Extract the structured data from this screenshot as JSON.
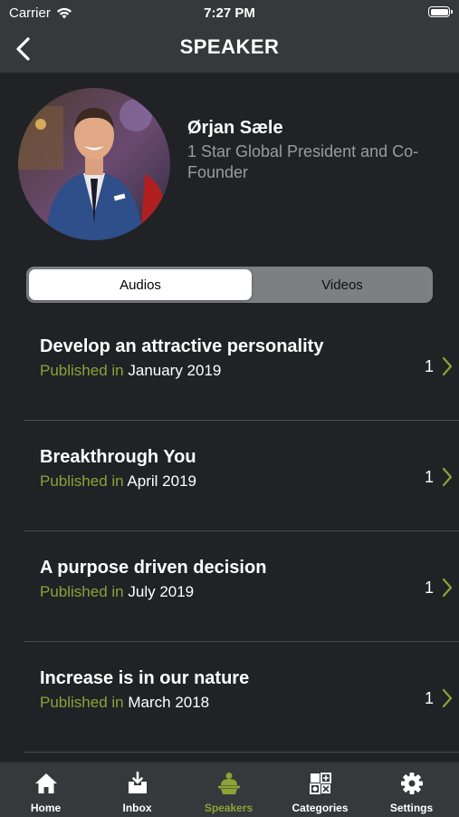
{
  "status_bar": {
    "carrier": "Carrier",
    "time": "7:27 PM"
  },
  "header": {
    "title": "SPEAKER",
    "back_icon": "chevron-left-icon"
  },
  "speaker": {
    "name": "Ørjan Sæle",
    "role": "1 Star Global President and Co-Founder"
  },
  "segments": {
    "audios": "Audios",
    "videos": "Videos",
    "selected": "Audios"
  },
  "published_label": "Published in",
  "items": [
    {
      "title": "Develop an attractive personality",
      "date": "January 2019",
      "count": "1"
    },
    {
      "title": "Breakthrough You",
      "date": "April 2019",
      "count": "1"
    },
    {
      "title": "A purpose driven decision",
      "date": "July 2019",
      "count": "1"
    },
    {
      "title": "Increase is in our nature",
      "date": "March 2018",
      "count": "1"
    }
  ],
  "tabs": [
    {
      "label": "Home",
      "icon": "home-icon"
    },
    {
      "label": "Inbox",
      "icon": "inbox-icon"
    },
    {
      "label": "Speakers",
      "icon": "speakers-icon"
    },
    {
      "label": "Categories",
      "icon": "categories-icon"
    },
    {
      "label": "Settings",
      "icon": "settings-icon"
    }
  ],
  "selected_tab": "Speakers",
  "colors": {
    "accent": "#8ba337",
    "background": "#212226",
    "bar": "#37383c"
  }
}
